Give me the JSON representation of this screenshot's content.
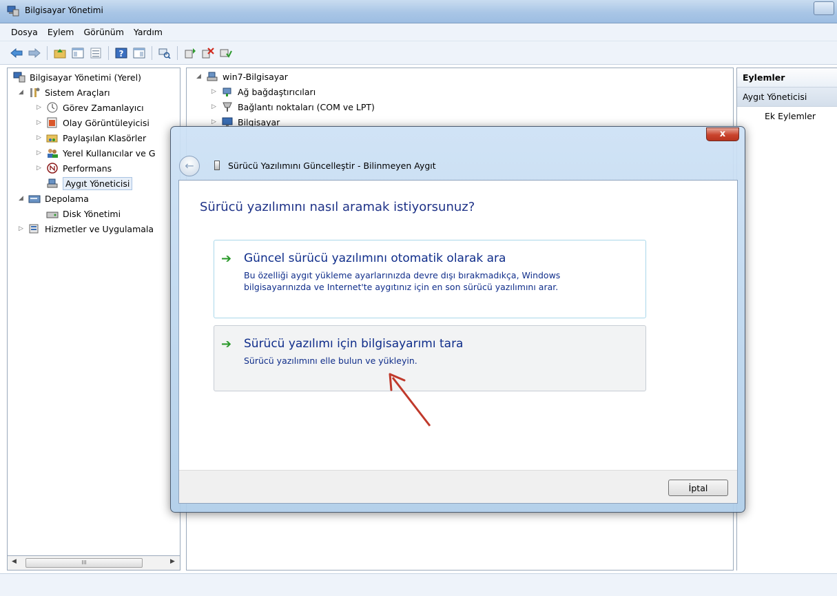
{
  "window": {
    "title": "Bilgisayar Yönetimi"
  },
  "menu": [
    "Dosya",
    "Eylem",
    "Görünüm",
    "Yardım"
  ],
  "tree": {
    "root": "Bilgisayar Yönetimi (Yerel)",
    "system_tools": "Sistem Araçları",
    "task_scheduler": "Görev Zamanlayıcı",
    "event_viewer": "Olay Görüntüleyicisi",
    "shared_folders": "Paylaşılan Klasörler",
    "local_users": "Yerel Kullanıcılar ve G",
    "performance": "Performans",
    "device_manager": "Aygıt Yöneticisi",
    "storage": "Depolama",
    "disk_management": "Disk Yönetimi",
    "services": "Hizmetler ve Uygulamala"
  },
  "scroll": {
    "thumb_label": "III"
  },
  "devices": {
    "computer": "win7-Bilgisayar",
    "network_adapters": "Ağ bağdaştırıcıları",
    "ports": "Bağlantı noktaları (COM ve LPT)",
    "computer_node": "Bilgisayar"
  },
  "actions": {
    "header": "Eylemler",
    "section": "Aygıt Yöneticisi",
    "more": "Ek Eylemler"
  },
  "dialog": {
    "close_label": "x",
    "title": "Sürücü Yazılımını Güncelleştir - Bilinmeyen Aygıt",
    "heading": "Sürücü yazılımını nasıl aramak istiyorsunuz?",
    "option1_title": "Güncel sürücü yazılımını otomatik olarak ara",
    "option1_desc": "Bu özelliği aygıt yükleme ayarlarınızda devre dışı bırakmadıkça, Windows bilgisayarınızda ve Internet'te aygıtınız için en son sürücü yazılımını arar.",
    "option2_title": "Sürücü yazılımı için bilgisayarımı tara",
    "option2_desc": "Sürücü yazılımını elle bulun ve yükleyin.",
    "cancel_label": "İptal"
  },
  "colors": {
    "link_blue": "#0f2d8a",
    "heading_blue": "#1e3287",
    "arrow_green": "#2c9a2c",
    "annotation_red": "#c0392b"
  }
}
